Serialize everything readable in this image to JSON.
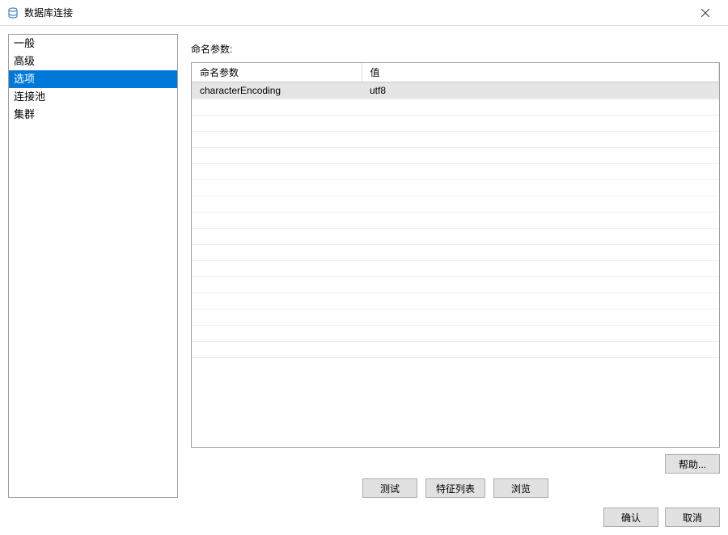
{
  "window": {
    "title": "数据库连接"
  },
  "sidebar": {
    "items": [
      {
        "label": "一般",
        "selected": false
      },
      {
        "label": "高级",
        "selected": false
      },
      {
        "label": "选项",
        "selected": true
      },
      {
        "label": "连接池",
        "selected": false
      },
      {
        "label": "集群",
        "selected": false
      }
    ]
  },
  "main": {
    "sectionLabel": "命名参数:",
    "tableHeaders": {
      "name": "命名参数",
      "value": "值"
    },
    "rows": [
      {
        "name": "characterEncoding",
        "value": "utf8"
      }
    ],
    "helpButton": "帮助..."
  },
  "centerButtons": {
    "test": "测试",
    "featureList": "特征列表",
    "browse": "浏览"
  },
  "dialogButtons": {
    "ok": "确认",
    "cancel": "取消"
  }
}
